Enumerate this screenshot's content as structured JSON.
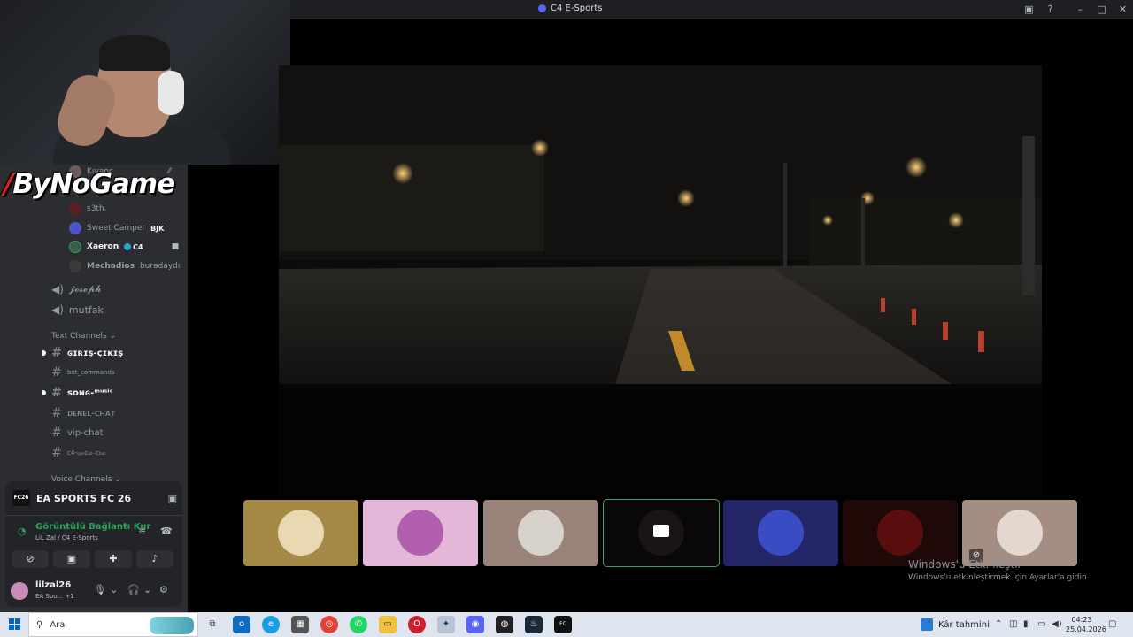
{
  "window": {
    "title": "C4 E-Sports"
  },
  "logo": {
    "text": "ByNoGame"
  },
  "voice_users": [
    {
      "name": "Kıvanç",
      "badge": "",
      "bold": false
    },
    {
      "name": "s3th.",
      "badge": "",
      "bold": false
    },
    {
      "name": "Sweet Camper",
      "badge": "BJK",
      "bold": false
    },
    {
      "name": "Xaeron",
      "badge": "C4",
      "bold": true
    },
    {
      "name": "Mechadios",
      "badge": "buradaydı",
      "bold": false
    }
  ],
  "voice_channels": [
    "𝓳𝓸𝓼𝓮𝓹𝓱",
    "mutfak"
  ],
  "categories": {
    "text": "Text Channels",
    "voice": "Voice Channels"
  },
  "text_channels": [
    {
      "name": "ɢɪʀɪş-çɪᴋɪş",
      "unread": true
    },
    {
      "name": "bot_commands",
      "unread": false
    },
    {
      "name": "ꜱᴏɴɢ-ᵐᵘˢⁱᶜ",
      "unread": true
    },
    {
      "name": "ᴅᴇɴᴇʟ-ᴄʜᴀᴛ",
      "unread": false
    },
    {
      "name": "vip-chat",
      "unread": false
    },
    {
      "name": "c4-ₛₚₑcᵢₐₗ₋cₕₐₜ",
      "unread": false
    }
  ],
  "activity": {
    "game": "EA SPORTS FC 26",
    "logo_text": "FC26"
  },
  "rtc": {
    "title": "Görüntülü Bağlantı Kur",
    "subtitle": "LiL Zal / C4 E-Sports"
  },
  "user": {
    "name": "lilzal26",
    "status": "EA Spo...",
    "extra": "+1"
  },
  "windows_activation": {
    "title": "Windows'u Etkinleştir",
    "subtitle": "Windows'u etkinleştirmek için Ayarlar'a gidin."
  },
  "taskbar": {
    "search_placeholder": "Ara",
    "weather": "Kâr tahmini",
    "time": "04:23",
    "date": "25.04.2026"
  },
  "colors": {
    "accent": "#5865f2",
    "online": "#23a55a",
    "sidebar": "#2b2d31"
  },
  "icons": [
    "search-icon",
    "camera-icon",
    "microphone-icon",
    "headphones-icon",
    "gear-icon",
    "hash-icon",
    "speaker-icon"
  ]
}
